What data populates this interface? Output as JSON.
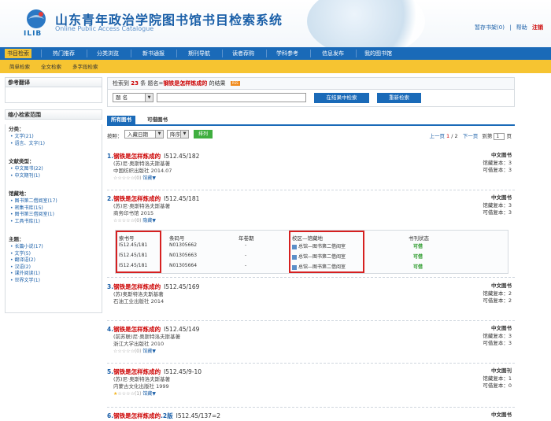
{
  "header": {
    "logo_text": "ILIB",
    "title": "山东青年政治学院图书馆书目检索系统",
    "subtitle": "Online Public Access Catalogue",
    "links": [
      "暂存书架(0)",
      "|",
      "帮助",
      "注销"
    ]
  },
  "nav": {
    "items": [
      "书目检索",
      "热门推荐",
      "分类浏览",
      "新书通报",
      "期刊导航",
      "读者荐购",
      "学科参考",
      "信息发布",
      "我的图书馆"
    ],
    "active": "书目检索"
  },
  "subnav": [
    "简单检索",
    "全文检索",
    "多字段检索"
  ],
  "sidebar": {
    "ref_title": "参考翻译",
    "narrow_title": "缩小检索范围",
    "sections": [
      {
        "title": "分类：",
        "items": [
          "文学(21)",
          "语言、文字(1)"
        ]
      },
      {
        "title": "文献类型：",
        "items": [
          "中文图书(22)",
          "中文期刊(1)"
        ]
      },
      {
        "title": "馆藏地：",
        "items": [
          "图书第二借阅室(17)",
          "密集书库(15)",
          "图书第三借阅室(1)",
          "工具书库(1)"
        ]
      },
      {
        "title": "主题：",
        "items": [
          "长篇小说(17)",
          "文学(5)",
          "翻译语(2)",
          "汉语(2)",
          "课外阅读(1)",
          "世界文学(1)"
        ]
      }
    ]
  },
  "summary": {
    "prefix": "检索到",
    "count": "23",
    "mid": "条 题名=",
    "query": "钢铁是怎样炼成的",
    "suffix": "的结果",
    "rss": "RSS"
  },
  "search": {
    "field": "题 名",
    "value": "",
    "btn_refine": "在结果中检索",
    "btn_new": "重新检索"
  },
  "tabs": [
    "所有图书",
    "可借图书"
  ],
  "sort": {
    "label": "按照：",
    "by": "入藏日期",
    "order": "降序",
    "btn": "排列"
  },
  "pager": {
    "prev": "上一页",
    "current": "1",
    "sep": "/",
    "total": "2",
    "next": "下一页",
    "goto": "到第",
    "page_box": "1",
    "page_unit": "页"
  },
  "records": [
    {
      "num": "1.",
      "title": "钢铁是怎样炼成的",
      "call": "I512.45/182",
      "author": "(苏)尼·奥斯特洛夫斯基著",
      "pub": "中国纺织出版社 2014.07",
      "rating": "(0)",
      "expand": "馆藏",
      "type": "中文图书",
      "total": "馆藏复本：3",
      "avail": "可借复本：3"
    },
    {
      "num": "2.",
      "title": "钢铁是怎样炼成的",
      "call": "I512.45/181",
      "author": "(苏)尼·奥斯特洛夫斯基著",
      "pub": "商务印书馆 2015",
      "rating": "(0)",
      "expand": "隐藏",
      "type": "中文图书",
      "total": "馆藏复本：3",
      "avail": "可借复本：3"
    },
    {
      "num": "3.",
      "title": "钢铁是怎样炼成的",
      "call": "I512.45/169",
      "author": "(苏)奥斯特洛夫斯基著",
      "pub": "石油工业出版社 2014",
      "rating": "",
      "expand": "",
      "type": "中文图书",
      "total": "馆藏复本：2",
      "avail": "可借复本：2"
    },
    {
      "num": "4.",
      "title": "钢铁是怎样炼成的",
      "call": "I512.45/149",
      "author": "(前苏联)尼·奥斯特洛夫斯基著",
      "pub": "浙江大学出版社 2010",
      "rating": "(0)",
      "expand": "馆藏",
      "type": "中文图书",
      "total": "馆藏复本：3",
      "avail": "可借复本：3"
    },
    {
      "num": "5.",
      "title": "钢铁是怎样炼成的",
      "call": "I512.45/9-10",
      "author": "(苏)尼·奥斯特洛夫斯基著",
      "pub": "内蒙古文化出版社 1999",
      "rating": "(1)",
      "expand": "馆藏",
      "type": "中文图刊",
      "total": "馆藏复本：1",
      "avail": "可借复本：0"
    },
    {
      "num": "6.",
      "title": "钢铁是怎样炼成的",
      "title_tail": ".2版",
      "call": "I512.45/137=2",
      "author": "",
      "pub": "",
      "rating": "",
      "expand": "",
      "type": "中文图书",
      "total": "",
      "avail": ""
    }
  ],
  "holdings": {
    "headers": [
      "索书号",
      "条码号",
      "年卷期",
      "校区—馆藏地",
      "书刊状态"
    ],
    "rows": [
      [
        "I512.45/181",
        "N01305662",
        "-",
        "总馆—图书第二借阅室",
        "可借"
      ],
      [
        "I512.45/181",
        "N01305663",
        "-",
        "总馆—图书第二借阅室",
        "可借"
      ],
      [
        "I512.45/181",
        "N01305664",
        "-",
        "总馆—图书第二借阅室",
        "可借"
      ]
    ]
  },
  "colors": {
    "nav": "#1a6ab8",
    "subnav": "#f6c431",
    "title_red": "#cc0000",
    "status_green": "#2a9a2a",
    "highlight_box": "#d62020"
  }
}
